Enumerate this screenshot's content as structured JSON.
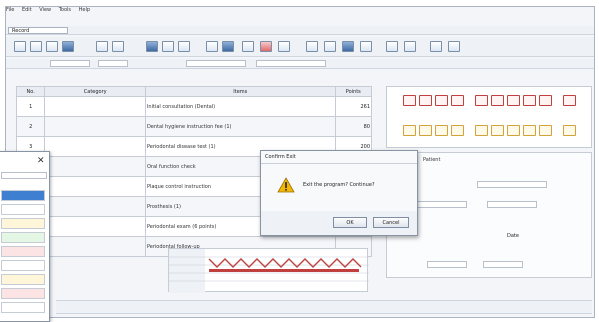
{
  "menu": {
    "items": [
      "File",
      "Edit",
      "View",
      "Tools",
      "Help"
    ]
  },
  "main": {
    "label_record": "Record",
    "label_items": "Items"
  },
  "table": {
    "headers": [
      "No.",
      "Category",
      "Items",
      "Points"
    ],
    "rows": [
      {
        "no": "1",
        "item": "Initial consultation (Dental)",
        "pts": "261"
      },
      {
        "no": "2",
        "item": "Dental hygiene instruction fee (1)",
        "pts": "80"
      },
      {
        "no": "3",
        "item": "Periodontal disease test (1)",
        "pts": "200"
      },
      {
        "no": "4",
        "item": "Oral function check",
        "pts": ""
      },
      {
        "no": "5",
        "item": "Plaque control instruction",
        "pts": ""
      },
      {
        "no": "6",
        "item": "Prosthesis (1)",
        "pts": "160"
      },
      {
        "no": "7",
        "item": "Periodontal exam (6 points)",
        "pts": ""
      },
      {
        "no": "8",
        "item": "Periodontal follow-up",
        "pts": ""
      }
    ]
  },
  "right_panel": {
    "fields": [
      "Patient",
      "Date"
    ]
  },
  "confirm_dialog": {
    "title": "Confirm Exit",
    "message": "Exit the program? Continue?",
    "ok_label": "OK",
    "cancel_label": "Cancel"
  },
  "colors": {
    "accent": "#3f6aa3",
    "warning": "#f2b705",
    "tooth_red": "#c04040"
  },
  "icons": {
    "warning": "warning-icon",
    "close": "close-icon"
  }
}
